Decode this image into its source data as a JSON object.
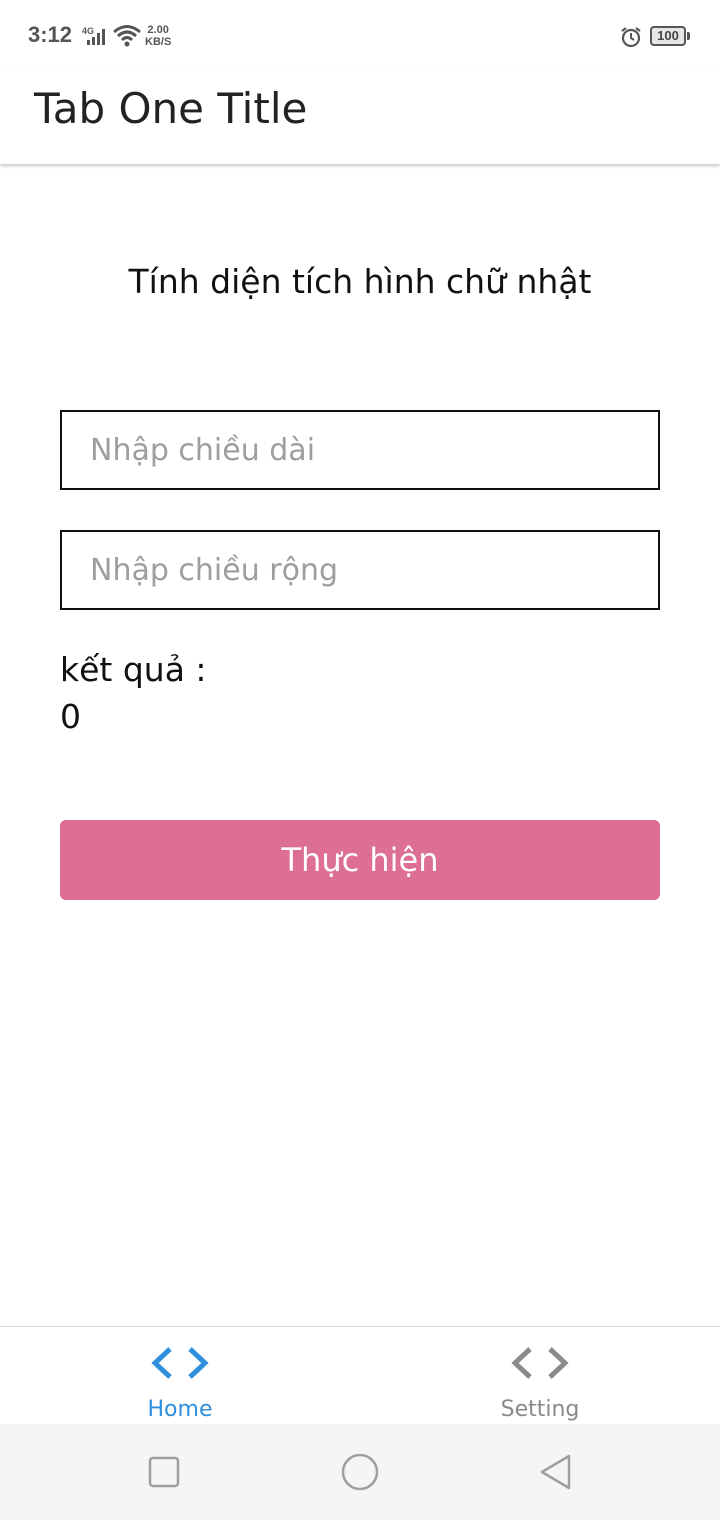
{
  "status_bar": {
    "time": "3:12",
    "network_type": "4G",
    "speed_value": "2.00",
    "speed_unit": "KB/S",
    "battery": "100",
    "icons": [
      "signal-icon",
      "wifi-icon",
      "alarm-icon",
      "battery-icon"
    ]
  },
  "app_bar": {
    "title": "Tab One Title"
  },
  "main": {
    "heading": "Tính diện tích hình chữ nhật",
    "length_input": {
      "placeholder": "Nhập chiều dài",
      "value": ""
    },
    "width_input": {
      "placeholder": "Nhập chiều rộng",
      "value": ""
    },
    "result_label": "kết quả :",
    "result_value": "0",
    "submit_label": "Thực hiện",
    "submit_color": "#dc6f92"
  },
  "tabs": [
    {
      "label": "Home",
      "icon": "code-icon",
      "active": true,
      "color": "#2f8fdd"
    },
    {
      "label": "Setting",
      "icon": "code-icon",
      "active": false,
      "color": "#8a8a8a"
    }
  ],
  "system_nav": {
    "icons": [
      "recent-apps-icon",
      "home-circle-icon",
      "back-triangle-icon"
    ]
  }
}
